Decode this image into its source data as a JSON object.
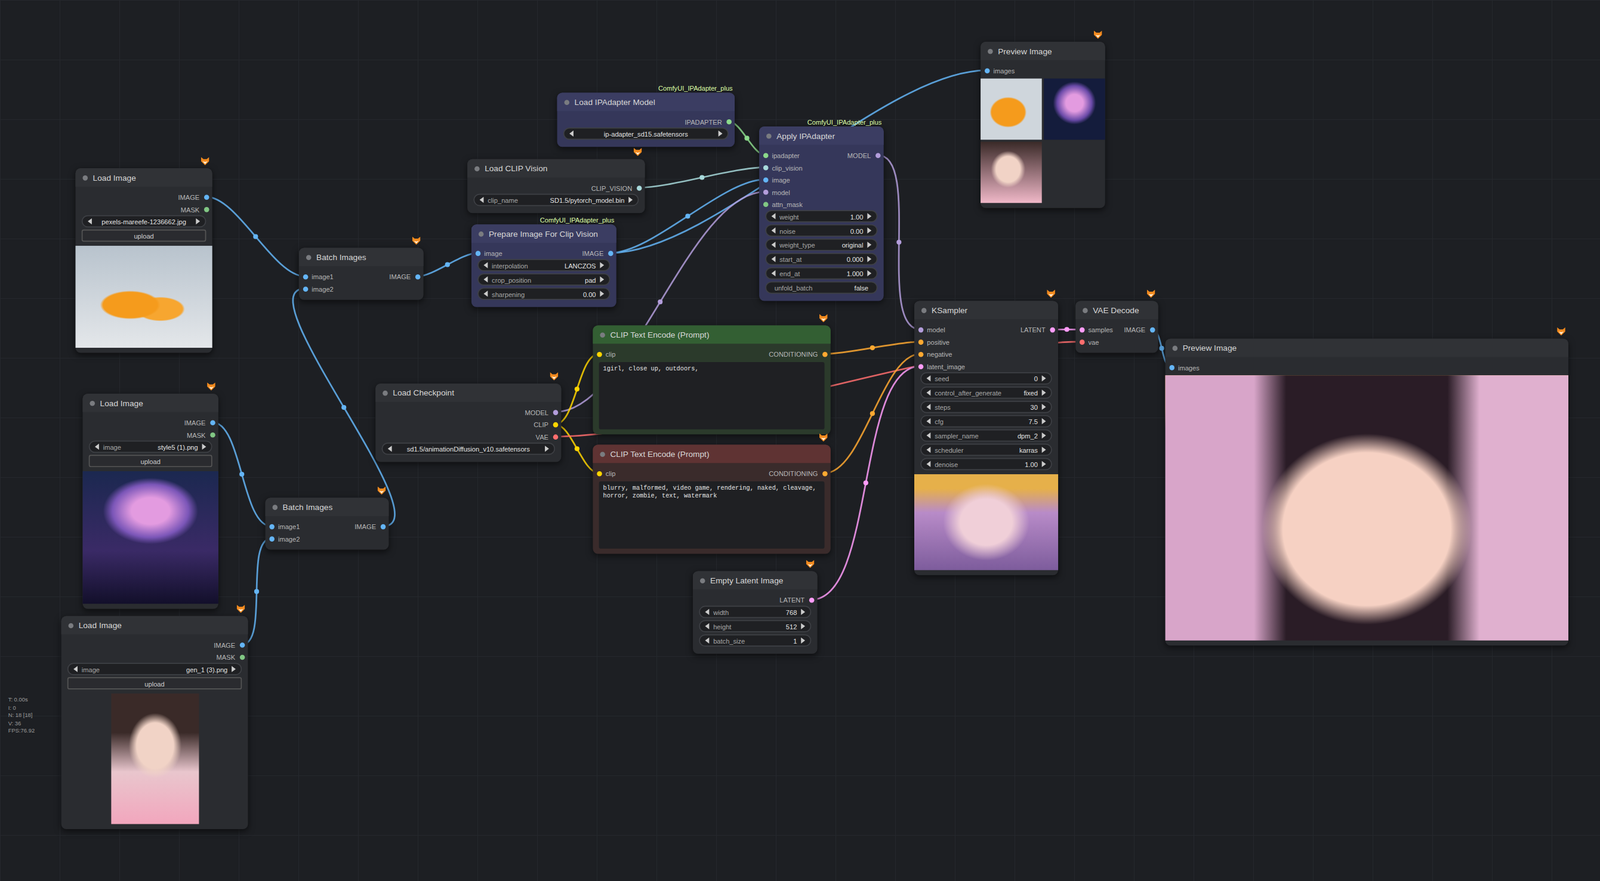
{
  "canvas": {
    "stats": [
      "T: 0.00s",
      "I: 0",
      "N: 18 [18]",
      "V: 36",
      "FPS:76.92"
    ]
  },
  "nodes": [
    {
      "title": "Load Image",
      "color": "#303236",
      "bgcolor": "#2a2c30",
      "inputs": [],
      "outputs": [
        {
          "label": "IMAGE",
          "color": "#64b5f6"
        },
        {
          "label": "MASK",
          "color": "#81c784"
        }
      ],
      "widgets": [
        {
          "kind": "combo",
          "value": "pexels-mareefe-1236662.jpg"
        },
        {
          "kind": "button",
          "value": "upload"
        },
        {
          "kind": "image"
        }
      ]
    },
    {
      "title": "Load Image",
      "color": "#303236",
      "bgcolor": "#2a2c30",
      "inputs": [],
      "outputs": [
        {
          "label": "IMAGE",
          "color": "#64b5f6"
        },
        {
          "label": "MASK",
          "color": "#81c784"
        }
      ],
      "widgets": [
        {
          "kind": "combo",
          "label": "image",
          "value": "style5 (1).png"
        },
        {
          "kind": "button",
          "value": "upload"
        },
        {
          "kind": "image"
        }
      ]
    },
    {
      "title": "Load Image",
      "color": "#303236",
      "bgcolor": "#2a2c30",
      "inputs": [],
      "outputs": [
        {
          "label": "IMAGE",
          "color": "#64b5f6"
        },
        {
          "label": "MASK",
          "color": "#81c784"
        }
      ],
      "widgets": [
        {
          "kind": "combo",
          "label": "image",
          "value": "gen_1 (3).png"
        },
        {
          "kind": "button",
          "value": "upload"
        },
        {
          "kind": "image"
        }
      ]
    },
    {
      "title": "Batch Images",
      "color": "#303236",
      "bgcolor": "#2a2c30",
      "inputs": [
        {
          "label": "image1",
          "color": "#64b5f6"
        },
        {
          "label": "image2",
          "color": "#64b5f6"
        }
      ],
      "outputs": [
        {
          "label": "IMAGE",
          "color": "#64b5f6"
        }
      ],
      "widgets": []
    },
    {
      "title": "Batch Images",
      "color": "#303236",
      "bgcolor": "#2a2c30",
      "inputs": [
        {
          "label": "image1",
          "color": "#64b5f6"
        },
        {
          "label": "image2",
          "color": "#64b5f6"
        }
      ],
      "outputs": [
        {
          "label": "IMAGE",
          "color": "#64b5f6"
        }
      ],
      "widgets": []
    },
    {
      "title": "Load IPAdapter Model",
      "badge": "ComfyUI_IPAdapter_plus",
      "color": "#3b3d62",
      "bgcolor": "#35375a",
      "inputs": [],
      "outputs": [
        {
          "label": "IPADAPTER",
          "color": "#8bd98b"
        }
      ],
      "widgets": [
        {
          "kind": "combo",
          "value": "ip-adapter_sd15.safetensors"
        }
      ]
    },
    {
      "title": "Load CLIP Vision",
      "color": "#303236",
      "bgcolor": "#2a2c30",
      "inputs": [],
      "outputs": [
        {
          "label": "CLIP_VISION",
          "color": "#a8dadc"
        }
      ],
      "widgets": [
        {
          "kind": "combo",
          "label": "clip_name",
          "value": "SD1.5/pytorch_model.bin"
        }
      ]
    },
    {
      "title": "Prepare Image For Clip Vision",
      "badge": "ComfyUI_IPAdapter_plus",
      "color": "#3b3d62",
      "bgcolor": "#35375a",
      "inputs": [
        {
          "label": "image",
          "color": "#64b5f6"
        }
      ],
      "outputs": [
        {
          "label": "IMAGE",
          "color": "#64b5f6"
        }
      ],
      "widgets": [
        {
          "kind": "combo",
          "label": "interpolation",
          "value": "LANCZOS"
        },
        {
          "kind": "combo",
          "label": "crop_position",
          "value": "pad"
        },
        {
          "kind": "number",
          "label": "sharpening",
          "value": "0.00"
        }
      ]
    },
    {
      "title": "Apply IPAdapter",
      "badge": "ComfyUI_IPAdapter_plus",
      "color": "#3b3d62",
      "bgcolor": "#35375a",
      "inputs": [
        {
          "label": "ipadapter",
          "color": "#8bd98b"
        },
        {
          "label": "clip_vision",
          "color": "#a8dadc"
        },
        {
          "label": "image",
          "color": "#64b5f6"
        },
        {
          "label": "model",
          "color": "#b39ddb"
        },
        {
          "label": "attn_mask",
          "color": "#81c784"
        }
      ],
      "outputs": [
        {
          "label": "MODEL",
          "color": "#b39ddb"
        }
      ],
      "widgets": [
        {
          "kind": "number",
          "label": "weight",
          "value": "1.00"
        },
        {
          "kind": "number",
          "label": "noise",
          "value": "0.00"
        },
        {
          "kind": "combo",
          "label": "weight_type",
          "value": "original"
        },
        {
          "kind": "number",
          "label": "start_at",
          "value": "0.000"
        },
        {
          "kind": "number",
          "label": "end_at",
          "value": "1.000"
        },
        {
          "kind": "toggle",
          "label": "unfold_batch",
          "value": "false"
        }
      ]
    },
    {
      "title": "Load Checkpoint",
      "color": "#303236",
      "bgcolor": "#2a2c30",
      "inputs": [],
      "outputs": [
        {
          "label": "MODEL",
          "color": "#b39ddb"
        },
        {
          "label": "CLIP",
          "color": "#ffd500"
        },
        {
          "label": "VAE",
          "color": "#ff6e6e"
        }
      ],
      "widgets": [
        {
          "kind": "combo",
          "value": "sd1.5/animationDiffusion_v10.safetensors"
        }
      ]
    },
    {
      "title": "CLIP Text Encode (Prompt)",
      "color": "#335f33",
      "bgcolor": "#2b3a2b",
      "inputs": [
        {
          "label": "clip",
          "color": "#ffd500"
        }
      ],
      "outputs": [
        {
          "label": "CONDITIONING",
          "color": "#ffa931"
        }
      ],
      "widgets": [
        {
          "kind": "text",
          "value": "1girl, close up, outdoors,"
        }
      ]
    },
    {
      "title": "CLIP Text Encode (Prompt)",
      "color": "#5f3333",
      "bgcolor": "#3a2b2b",
      "inputs": [
        {
          "label": "clip",
          "color": "#ffd500"
        }
      ],
      "outputs": [
        {
          "label": "CONDITIONING",
          "color": "#ffa931"
        }
      ],
      "widgets": [
        {
          "kind": "text",
          "value": "blurry, malformed, video game, rendering, naked, cleavage, horror, zombie, text, watermark"
        }
      ]
    },
    {
      "title": "Empty Latent Image",
      "color": "#303236",
      "bgcolor": "#2a2c30",
      "inputs": [],
      "outputs": [
        {
          "label": "LATENT",
          "color": "#ff9cf9"
        }
      ],
      "widgets": [
        {
          "kind": "number",
          "label": "width",
          "value": "768"
        },
        {
          "kind": "number",
          "label": "height",
          "value": "512"
        },
        {
          "kind": "number",
          "label": "batch_size",
          "value": "1"
        }
      ]
    },
    {
      "title": "KSampler",
      "color": "#303236",
      "bgcolor": "#2a2c30",
      "inputs": [
        {
          "label": "model",
          "color": "#b39ddb"
        },
        {
          "label": "positive",
          "color": "#ffa931"
        },
        {
          "label": "negative",
          "color": "#ffa931"
        },
        {
          "label": "latent_image",
          "color": "#ff9cf9"
        }
      ],
      "outputs": [
        {
          "label": "LATENT",
          "color": "#ff9cf9"
        }
      ],
      "widgets": [
        {
          "kind": "number",
          "label": "seed",
          "value": "0"
        },
        {
          "kind": "combo",
          "label": "control_after_generate",
          "value": "fixed"
        },
        {
          "kind": "number",
          "label": "steps",
          "value": "30"
        },
        {
          "kind": "number",
          "label": "cfg",
          "value": "7.5"
        },
        {
          "kind": "combo",
          "label": "sampler_name",
          "value": "dpm_2"
        },
        {
          "kind": "combo",
          "label": "scheduler",
          "value": "karras"
        },
        {
          "kind": "number",
          "label": "denoise",
          "value": "1.00"
        },
        {
          "kind": "image"
        }
      ]
    },
    {
      "title": "VAE Decode",
      "color": "#303236",
      "bgcolor": "#2a2c30",
      "inputs": [
        {
          "label": "samples",
          "color": "#ff9cf9"
        },
        {
          "label": "vae",
          "color": "#ff6e6e"
        }
      ],
      "outputs": [
        {
          "label": "IMAGE",
          "color": "#64b5f6"
        }
      ],
      "widgets": []
    },
    {
      "title": "Preview Image",
      "color": "#303236",
      "bgcolor": "#2a2c30",
      "inputs": [
        {
          "label": "images",
          "color": "#64b5f6"
        }
      ],
      "outputs": [],
      "widgets": [
        {
          "kind": "gallery",
          "tiles": 3
        }
      ]
    },
    {
      "title": "Preview Image",
      "color": "#303236",
      "bgcolor": "#2a2c30",
      "inputs": [
        {
          "label": "images",
          "color": "#64b5f6"
        }
      ],
      "outputs": [],
      "widgets": [
        {
          "kind": "image"
        }
      ]
    }
  ]
}
